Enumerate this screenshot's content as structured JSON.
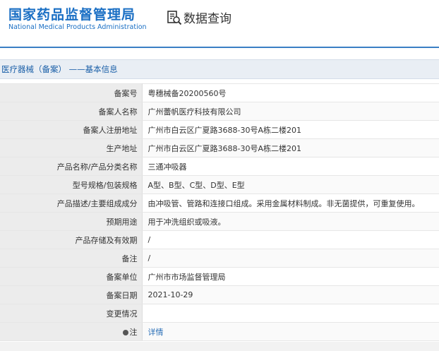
{
  "header": {
    "logo_cn": "国家药品监督管理局",
    "logo_en": "National Medical Products Administration",
    "query_label": "数据查询",
    "query_icon": "document-search-icon"
  },
  "section": {
    "title": "医疗器械（备案） ——基本信息"
  },
  "colors": {
    "brand_blue": "#1a6fc4",
    "row_key_bg": "#ececec",
    "link": "#2a6fb7"
  },
  "rows": [
    {
      "key": "备案号",
      "value": "粤穗械备20200560号"
    },
    {
      "key": "备案人名称",
      "value": "广州蕾帆医疗科技有限公司"
    },
    {
      "key": "备案人注册地址",
      "value": "广州市白云区广夏路3688-30号A栋二楼201"
    },
    {
      "key": "生产地址",
      "value": "广州市白云区广夏路3688-30号A栋二楼201"
    },
    {
      "key": "产品名称/产品分类名称",
      "value": "三通冲吸器"
    },
    {
      "key": "型号规格/包装规格",
      "value": "A型、B型、C型、D型、E型"
    },
    {
      "key": "产品描述/主要组成成分",
      "value": "由冲吸管、管路和连接口组成。采用金属材料制成。非无菌提供，可重复使用。"
    },
    {
      "key": "预期用途",
      "value": "用于冲洗组织或吸液。"
    },
    {
      "key": "产品存储及有效期",
      "value": "/"
    },
    {
      "key": "备注",
      "value": "/"
    },
    {
      "key": "备案单位",
      "value": "广州市市场监督管理局"
    },
    {
      "key": "备案日期",
      "value": "2021-10-29"
    },
    {
      "key": "变更情况",
      "value": ""
    },
    {
      "key": "注",
      "value": "详情",
      "icon": "pin-icon"
    }
  ]
}
